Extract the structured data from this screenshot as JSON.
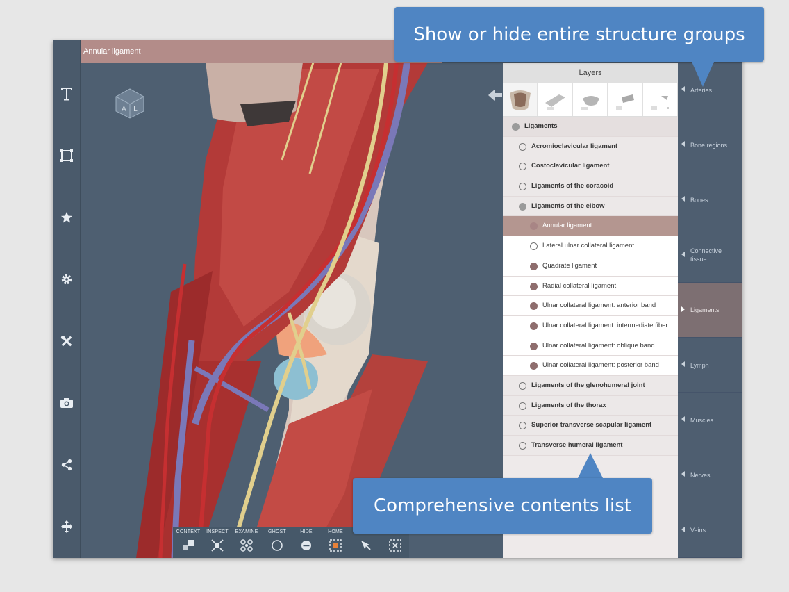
{
  "title_bar": {
    "title": "Annular ligament"
  },
  "left_toolbar": {
    "items": [
      {
        "name": "text-tool",
        "icon": "text-T-icon"
      },
      {
        "name": "frame-tool",
        "icon": "crop-frame-icon"
      },
      {
        "name": "favorites",
        "icon": "star-icon"
      },
      {
        "name": "settings",
        "icon": "gear-icon"
      },
      {
        "name": "tools",
        "icon": "wrench-cross-icon"
      },
      {
        "name": "snapshot",
        "icon": "camera-icon"
      },
      {
        "name": "share",
        "icon": "share-icon"
      },
      {
        "name": "move",
        "icon": "move-arrows-icon"
      }
    ]
  },
  "viewport": {
    "viewcube_label": "A L",
    "nav": {
      "back_icon": "arrow-left-icon",
      "forward_icon": "arrow-right-icon"
    }
  },
  "bottom_toolbar": {
    "buttons": [
      {
        "label": "CONTEXT",
        "icon": "context-icon"
      },
      {
        "label": "INSPECT",
        "icon": "inspect-icon"
      },
      {
        "label": "EXAMINE",
        "icon": "examine-icon"
      },
      {
        "label": "GHOST",
        "icon": "ghost-circle-icon"
      },
      {
        "label": "HIDE",
        "icon": "hide-minus-icon"
      },
      {
        "label": "HOME",
        "icon": "home-icon"
      },
      {
        "label": "",
        "icon": "pointer-icon"
      },
      {
        "label": "",
        "icon": "close-box-icon"
      }
    ]
  },
  "layers_panel": {
    "header": "Layers",
    "thumbnails_count_shown": 5,
    "rows": [
      {
        "label": "Ligaments",
        "level": "group",
        "dot": "grey"
      },
      {
        "label": "Acromioclavicular ligament",
        "level": "l1",
        "dot": "hollow"
      },
      {
        "label": "Costoclavicular ligament",
        "level": "l1",
        "dot": "hollow"
      },
      {
        "label": "Ligaments of the coracoid",
        "level": "l1",
        "dot": "hollow"
      },
      {
        "label": "Ligaments of the elbow",
        "level": "l1",
        "dot": "grey"
      },
      {
        "label": "Annular ligament",
        "level": "sel",
        "dot": "roselight"
      },
      {
        "label": "Lateral ulnar collateral ligament",
        "level": "l2",
        "dot": "hollow"
      },
      {
        "label": "Quadrate ligament",
        "level": "l2",
        "dot": "rose"
      },
      {
        "label": "Radial collateral ligament",
        "level": "l2",
        "dot": "rose"
      },
      {
        "label": "Ulnar collateral ligament: anterior band",
        "level": "l2",
        "dot": "rose"
      },
      {
        "label": "Ulnar collateral ligament: intermediate fiber",
        "level": "l2",
        "dot": "rose"
      },
      {
        "label": "Ulnar collateral ligament: oblique band",
        "level": "l2",
        "dot": "rose"
      },
      {
        "label": "Ulnar collateral ligament: posterior band",
        "level": "l2",
        "dot": "rose"
      },
      {
        "label": "Ligaments of the glenohumeral joint",
        "level": "l1",
        "dot": "hollow"
      },
      {
        "label": "Ligaments of the thorax",
        "level": "l1",
        "dot": "hollow"
      },
      {
        "label": "Superior transverse scapular ligament",
        "level": "l1",
        "dot": "hollow"
      },
      {
        "label": "Transverse humeral ligament",
        "level": "l1",
        "dot": "hollow"
      }
    ]
  },
  "categories": [
    {
      "label": "Arteries",
      "active": false
    },
    {
      "label": "Bone regions",
      "active": false
    },
    {
      "label": "Bones",
      "active": false
    },
    {
      "label": "Connective tissue",
      "active": false
    },
    {
      "label": "Ligaments",
      "active": true
    },
    {
      "label": "Lymph",
      "active": false
    },
    {
      "label": "Muscles",
      "active": false
    },
    {
      "label": "Nerves",
      "active": false
    },
    {
      "label": "Veins",
      "active": false
    }
  ],
  "callouts": {
    "top": "Show or hide entire structure groups",
    "bottom": "Comprehensive contents list"
  },
  "colors": {
    "title_bar": "#b38c89",
    "selected_row": "#b49690",
    "callout": "#4f85c3",
    "active_category": "#7d6f72"
  }
}
